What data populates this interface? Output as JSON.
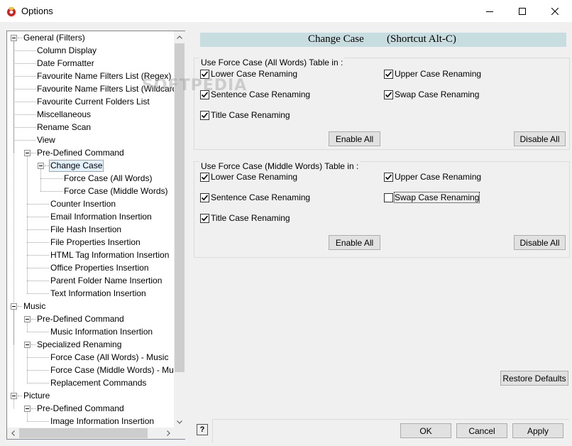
{
  "window": {
    "title": "Options",
    "controls": [
      "minimize",
      "maximize",
      "close"
    ]
  },
  "tree": {
    "items": [
      {
        "label": "General  (Filters)",
        "level": 0,
        "expanded": true
      },
      {
        "label": "Column Display",
        "level": 1
      },
      {
        "label": "Date Formatter",
        "level": 1
      },
      {
        "label": "Favourite Name Filters List (Regex)",
        "level": 1
      },
      {
        "label": "Favourite Name Filters List (Wildcard",
        "level": 1
      },
      {
        "label": "Favourite Current Folders List",
        "level": 1
      },
      {
        "label": "Miscellaneous",
        "level": 1
      },
      {
        "label": "Rename Scan",
        "level": 1
      },
      {
        "label": "View",
        "level": 1
      },
      {
        "label": "Pre-Defined Command",
        "level": 1,
        "expanded": true
      },
      {
        "label": "Change Case",
        "level": 2,
        "expanded": true,
        "selected": true
      },
      {
        "label": "Force Case (All Words)",
        "level": 3
      },
      {
        "label": "Force Case (Middle Words)",
        "level": 3
      },
      {
        "label": "Counter Insertion",
        "level": 2
      },
      {
        "label": "Email Information Insertion",
        "level": 2
      },
      {
        "label": "File Hash Insertion",
        "level": 2
      },
      {
        "label": "File Properties Insertion",
        "level": 2
      },
      {
        "label": "HTML Tag Information Insertion",
        "level": 2
      },
      {
        "label": "Office Properties Insertion",
        "level": 2
      },
      {
        "label": "Parent Folder Name Insertion",
        "level": 2
      },
      {
        "label": "Text Information Insertion",
        "level": 2
      },
      {
        "label": "Music",
        "level": 0,
        "expanded": true
      },
      {
        "label": "Pre-Defined Command",
        "level": 1,
        "expanded": true
      },
      {
        "label": "Music Information Insertion",
        "level": 2
      },
      {
        "label": "Specialized Renaming",
        "level": 1,
        "expanded": true
      },
      {
        "label": "Force Case (All Words) - Music",
        "level": 2
      },
      {
        "label": "Force Case (Middle Words) - Mu",
        "level": 2
      },
      {
        "label": "Replacement Commands",
        "level": 2
      },
      {
        "label": "Picture",
        "level": 0,
        "expanded": true
      },
      {
        "label": "Pre-Defined Command",
        "level": 1,
        "expanded": true
      },
      {
        "label": "Image Information Insertion",
        "level": 2
      }
    ]
  },
  "header": {
    "title": "Change Case",
    "shortcut": "(Shortcut Alt-C)"
  },
  "group_all": {
    "title": "Use Force Case (All Words) Table in :",
    "checks": [
      {
        "label": "Lower Case Renaming",
        "checked": true
      },
      {
        "label": "Upper Case Renaming",
        "checked": true
      },
      {
        "label": "Sentence Case Renaming",
        "checked": true
      },
      {
        "label": "Swap Case Renaming",
        "checked": true
      },
      {
        "label": "Title Case Renaming",
        "checked": true
      }
    ],
    "enable_all": "Enable All",
    "disable_all": "Disable All"
  },
  "group_middle": {
    "title": "Use Force Case (Middle Words) Table in :",
    "checks": [
      {
        "label": "Lower Case Renaming",
        "checked": true
      },
      {
        "label": "Upper Case Renaming",
        "checked": true
      },
      {
        "label": "Sentence Case Renaming",
        "checked": true
      },
      {
        "label": "Swap Case Renaming",
        "checked": false
      },
      {
        "label": "Title Case Renaming",
        "checked": true
      }
    ],
    "enable_all": "Enable All",
    "disable_all": "Disable All"
  },
  "footer": {
    "restore_defaults": "Restore Defaults",
    "help": "?",
    "ok": "OK",
    "cancel": "Cancel",
    "apply": "Apply"
  },
  "watermark": "SOFTPEDIA"
}
